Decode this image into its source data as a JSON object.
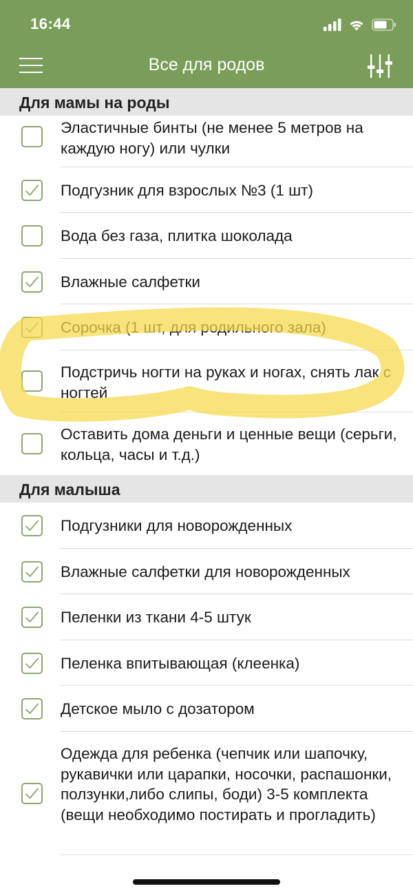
{
  "status_bar": {
    "time": "16:44"
  },
  "header": {
    "title": "Все для родов",
    "menu_icon": "hamburger-menu-icon",
    "filter_icon": "sliders-icon",
    "background": "#7a9e5a"
  },
  "sections": [
    {
      "title": "Для мамы на роды"
    },
    {
      "title": "Для малыша"
    }
  ],
  "items_mom": [
    {
      "label": "Эластичные бинты (не менее 5 метров на каждую ногу) или чулки",
      "checked": false
    },
    {
      "label": "Подгузник для взрослых №3 (1 шт)",
      "checked": true
    },
    {
      "label": "Вода без газа, плитка шоколада",
      "checked": false
    },
    {
      "label": "Влажные салфетки",
      "checked": true
    },
    {
      "label": "Сорочка (1 шт, для родильного зала)",
      "checked": true
    },
    {
      "label": "Подстричь ногти на руках и ногах, снять лак с ногтей",
      "checked": false
    },
    {
      "label": "Оставить дома деньги и ценные вещи (серьги, кольца, часы и т.д.)",
      "checked": false
    }
  ],
  "items_baby": [
    {
      "label": "Подгузники для новорожденных",
      "checked": true
    },
    {
      "label": "Влажные салфетки для новорожденных",
      "checked": true
    },
    {
      "label": "Пеленки из ткани 4-5 штук",
      "checked": true
    },
    {
      "label": "Пеленка впитывающая (клеенка)",
      "checked": true
    },
    {
      "label": "Детское мыло с дозатором",
      "checked": true
    },
    {
      "label": "Одежда для ребенка (чепчик или шапочку, рукавички или царапки, носочки, распашонки, ползунки,либо слипы, боди) 3-5 комплекта (вещи необходимо постирать и прогладить)",
      "checked": true
    }
  ],
  "colors": {
    "accent": "#7a9e5a",
    "checkbox_border": "#8aa86e",
    "section_bg": "#e5e5e5",
    "highlight": "#f7d84a"
  }
}
